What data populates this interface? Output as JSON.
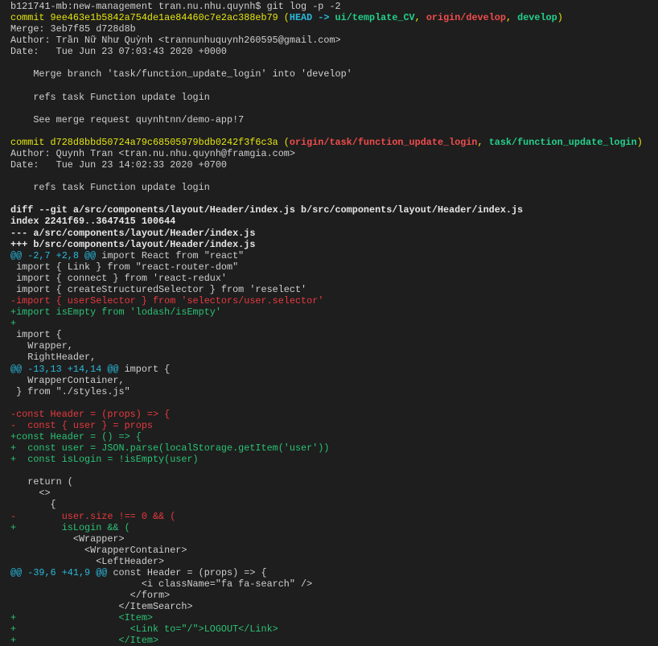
{
  "terminal": {
    "colors": {
      "background": "#1e1e1e",
      "text": "#cfcfcf",
      "yellow": "#e5e510",
      "cyan": "#29b8db",
      "green": "#23d18b",
      "red": "#f14c4c"
    },
    "lines": [
      [
        {
          "t": "b121741-mb:new-management tran.nu.nhu.quynh$ git log -p -2",
          "c": "default"
        }
      ],
      [
        {
          "t": "commit 9ee463e1b5842a754de1ae84460c7e2ac388eb79 (",
          "c": "yellow"
        },
        {
          "t": "HEAD -> ",
          "c": "cyanb"
        },
        {
          "t": "ui/template_CV",
          "c": "greenb"
        },
        {
          "t": ", ",
          "c": "yellow"
        },
        {
          "t": "origin/develop",
          "c": "redb"
        },
        {
          "t": ", ",
          "c": "yellow"
        },
        {
          "t": "develop",
          "c": "greenb"
        },
        {
          "t": ")",
          "c": "yellow"
        }
      ],
      [
        {
          "t": "Merge: 3eb7f85 d728d8b",
          "c": "default"
        }
      ],
      [
        {
          "t": "Author: Trần Nữ Như Quỳnh <trannunhuquynh260595@gmail.com>",
          "c": "default"
        }
      ],
      [
        {
          "t": "Date:   Tue Jun 23 07:03:43 2020 +0000",
          "c": "default"
        }
      ],
      [],
      [
        {
          "t": "    Merge branch 'task/function_update_login' into 'develop'",
          "c": "default"
        }
      ],
      [],
      [
        {
          "t": "    refs task Function update login",
          "c": "default"
        }
      ],
      [],
      [
        {
          "t": "    See merge request quynhtnn/demo-app!7",
          "c": "default"
        }
      ],
      [],
      [
        {
          "t": "commit d728d8bbd50724a79c68505979bdb0242f3f6c3a (",
          "c": "yellow"
        },
        {
          "t": "origin/task/function_update_login",
          "c": "redb"
        },
        {
          "t": ", ",
          "c": "yellow"
        },
        {
          "t": "task/function_update_login",
          "c": "greenb"
        },
        {
          "t": ")",
          "c": "yellow"
        }
      ],
      [
        {
          "t": "Author: Quynh Tran <tran.nu.nhu.quynh@framgia.com>",
          "c": "default"
        }
      ],
      [
        {
          "t": "Date:   Tue Jun 23 14:02:33 2020 +0700",
          "c": "default"
        }
      ],
      [],
      [
        {
          "t": "    refs task Function update login",
          "c": "default"
        }
      ],
      [],
      [
        {
          "t": "diff --git a/src/components/layout/Header/index.js b/src/components/layout/Header/index.js",
          "c": "meta"
        }
      ],
      [
        {
          "t": "index 2241f69..3647415 100644",
          "c": "meta"
        }
      ],
      [
        {
          "t": "--- a/src/components/layout/Header/index.js",
          "c": "meta"
        }
      ],
      [
        {
          "t": "+++ b/src/components/layout/Header/index.js",
          "c": "meta"
        }
      ],
      [
        {
          "t": "@@ -2,7 +2,8 @@",
          "c": "cyan"
        },
        {
          "t": " import React from \"react\"",
          "c": "default"
        }
      ],
      [
        {
          "t": " import { Link } from \"react-router-dom\"",
          "c": "default"
        }
      ],
      [
        {
          "t": " import { connect } from 'react-redux'",
          "c": "default"
        }
      ],
      [
        {
          "t": " import { createStructuredSelector } from 'reselect'",
          "c": "default"
        }
      ],
      [
        {
          "t": "-import { userSelector } from 'selectors/user.selector'",
          "c": "red"
        }
      ],
      [
        {
          "t": "+import isEmpty from 'lodash/isEmpty'",
          "c": "green"
        }
      ],
      [
        {
          "t": "+",
          "c": "green"
        }
      ],
      [
        {
          "t": " import {",
          "c": "default"
        }
      ],
      [
        {
          "t": "   Wrapper,",
          "c": "default"
        }
      ],
      [
        {
          "t": "   RightHeader,",
          "c": "default"
        }
      ],
      [
        {
          "t": "@@ -13,13 +14,14 @@",
          "c": "cyan"
        },
        {
          "t": " import {",
          "c": "default"
        }
      ],
      [
        {
          "t": "   WrapperContainer,",
          "c": "default"
        }
      ],
      [
        {
          "t": " } from \"./styles.js\"",
          "c": "default"
        }
      ],
      [],
      [
        {
          "t": "-const Header = (props) => {",
          "c": "red"
        }
      ],
      [
        {
          "t": "-  const { user } = props",
          "c": "red"
        }
      ],
      [
        {
          "t": "+const Header = () => {",
          "c": "green"
        }
      ],
      [
        {
          "t": "+  const user = JSON.parse(localStorage.getItem('user'))",
          "c": "green"
        }
      ],
      [
        {
          "t": "+  const isLogin = !isEmpty(user)",
          "c": "green"
        }
      ],
      [],
      [
        {
          "t": "   return (",
          "c": "default"
        }
      ],
      [
        {
          "t": "     <>",
          "c": "default"
        }
      ],
      [
        {
          "t": "       {",
          "c": "default"
        }
      ],
      [
        {
          "t": "-        user.size !== 0 && (",
          "c": "red"
        }
      ],
      [
        {
          "t": "+        isLogin && (",
          "c": "green"
        }
      ],
      [
        {
          "t": "           <Wrapper>",
          "c": "default"
        }
      ],
      [
        {
          "t": "             <WrapperContainer>",
          "c": "default"
        }
      ],
      [
        {
          "t": "               <LeftHeader>",
          "c": "default"
        }
      ],
      [
        {
          "t": "@@ -39,6 +41,9 @@",
          "c": "cyan"
        },
        {
          "t": " const Header = (props) => {",
          "c": "default"
        }
      ],
      [
        {
          "t": "                       <i className=\"fa fa-search\" />",
          "c": "default"
        }
      ],
      [
        {
          "t": "                     </form>",
          "c": "default"
        }
      ],
      [
        {
          "t": "                   </ItemSearch>",
          "c": "default"
        }
      ],
      [
        {
          "t": "+                  <Item>",
          "c": "green"
        }
      ],
      [
        {
          "t": "+                    <Link to=\"/\">LOGOUT</Link>",
          "c": "green"
        }
      ],
      [
        {
          "t": "+                  </Item>",
          "c": "green"
        }
      ]
    ]
  }
}
